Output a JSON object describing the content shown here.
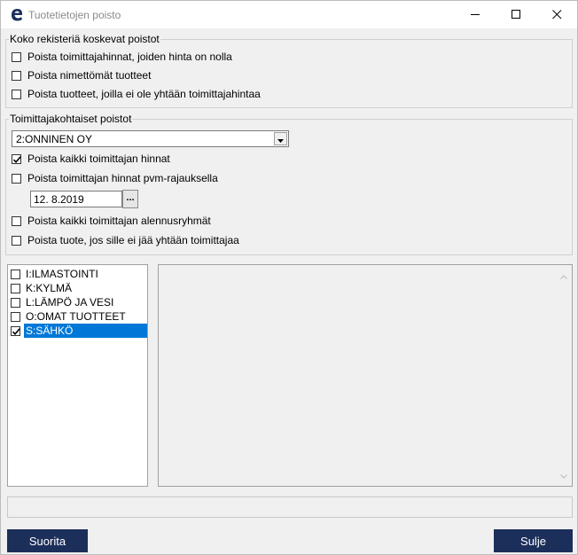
{
  "window": {
    "title": "Tuotetietojen poisto",
    "app_icon": "e-logo-icon",
    "controls": [
      "minimize-icon",
      "maximize-icon",
      "close-icon"
    ]
  },
  "general_deletions": {
    "legend": "Koko rekisteriä koskevat poistot",
    "options": [
      {
        "label": "Poista toimittajahinnat, joiden hinta on nolla",
        "checked": false
      },
      {
        "label": "Poista nimettömät tuotteet",
        "checked": false
      },
      {
        "label": "Poista tuotteet, joilla ei ole yhtään toimittajahintaa",
        "checked": false
      }
    ]
  },
  "supplier_deletions": {
    "legend": "Toimittajakohtaiset poistot",
    "supplier_select": {
      "value": "2:ONNINEN OY"
    },
    "options": [
      {
        "label": "Poista kaikki toimittajan hinnat",
        "checked": true
      },
      {
        "label": "Poista toimittajan hinnat pvm-rajauksella",
        "checked": false
      },
      {
        "label": "Poista kaikki toimittajan alennusryhmät",
        "checked": false
      },
      {
        "label": "Poista tuote, jos sille ei jää yhtään toimittajaa",
        "checked": false
      }
    ],
    "date_input": {
      "value": "12. 8.2019",
      "button_label": "..."
    }
  },
  "groups_list": {
    "items": [
      {
        "label": "I:ILMASTOINTI",
        "checked": false,
        "selected": false
      },
      {
        "label": "K:KYLMÄ",
        "checked": false,
        "selected": false
      },
      {
        "label": "L:LÄMPÖ JA VESI",
        "checked": false,
        "selected": false
      },
      {
        "label": "O:OMAT TUOTTEET",
        "checked": false,
        "selected": false
      },
      {
        "label": "S:SÄHKÖ",
        "checked": true,
        "selected": true
      }
    ]
  },
  "colors": {
    "selection": "#0078d7",
    "button_bg": "#1c2f5b",
    "window_bg": "#f0f0f0"
  },
  "buttons": {
    "run_label": "Suorita",
    "close_label": "Sulje"
  }
}
